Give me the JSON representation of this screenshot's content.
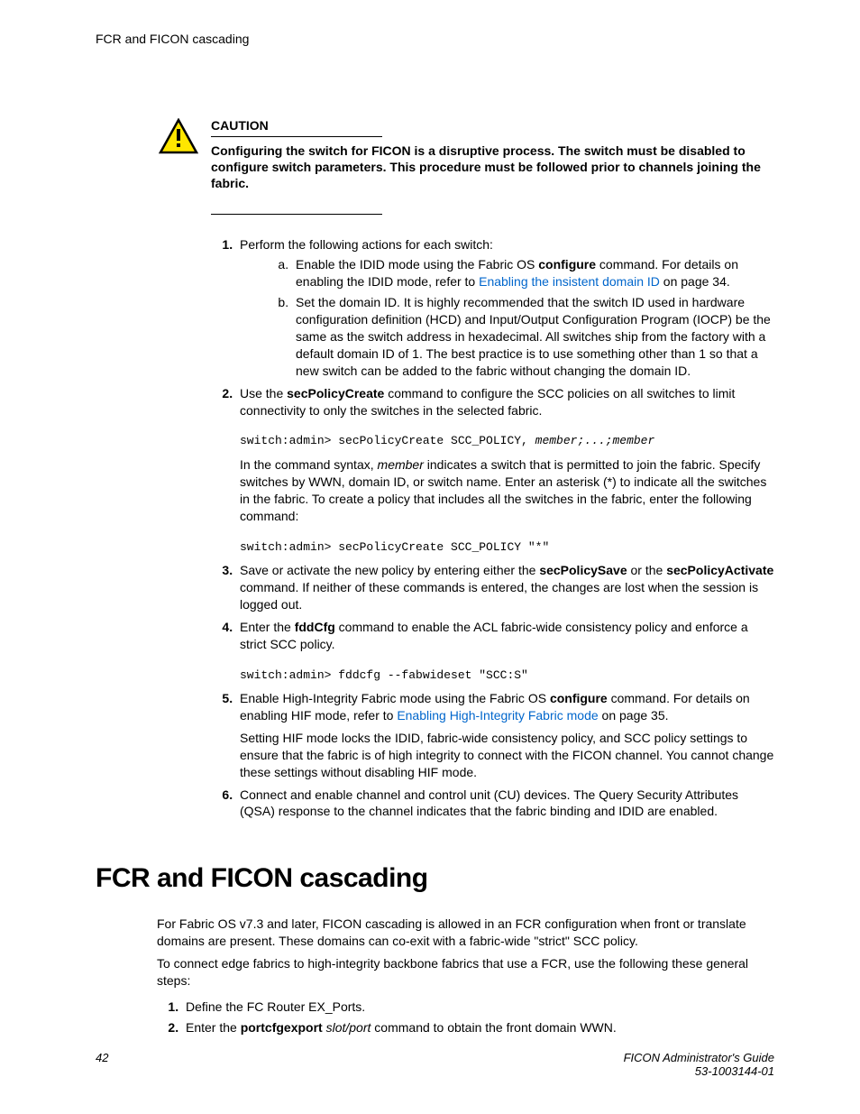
{
  "header": {
    "running": "FCR and FICON cascading"
  },
  "caution": {
    "label": "CAUTION",
    "text": "Configuring the switch for FICON is a disruptive process. The switch must be disabled to configure switch parameters. This procedure must be followed prior to channels joining the fabric."
  },
  "steps": {
    "s1": {
      "text": "Perform the following actions for each switch:",
      "a_pre": "Enable the IDID mode using the Fabric OS ",
      "a_cmd": "configure",
      "a_mid": " command. For details on enabling the IDID mode, refer to ",
      "a_link": "Enabling the insistent domain ID",
      "a_post": " on page 34.",
      "b": "Set the domain ID. It is highly recommended that the switch ID used in hardware configuration definition (HCD) and Input/Output Configuration Program (IOCP) be the same as the switch address in hexadecimal. All switches ship from the factory with a default domain ID of 1. The best practice is to use something other than 1 so that a new switch can be added to the fabric without changing the domain ID."
    },
    "s2": {
      "pre": "Use the ",
      "cmd": "secPolicyCreate",
      "post": " command to configure the SCC policies on all switches to limit connectivity to only the switches in the selected fabric.",
      "code1_a": "switch:admin> secPolicyCreate SCC_POLICY, ",
      "code1_b": "member;...;member",
      "p2a": "In the command syntax, ",
      "p2b": "member",
      "p2c": " indicates a switch that is permitted to join the fabric. Specify switches by WWN, domain ID, or switch name. Enter an asterisk (*) to indicate all the switches in the fabric. To create a policy that includes all the switches in the fabric, enter the following command:",
      "code2": "switch:admin> secPolicyCreate SCC_POLICY \"*\""
    },
    "s3": {
      "pre": "Save or activate the new policy by entering either the ",
      "cmd1": "secPolicySave",
      "mid": " or the ",
      "cmd2": "secPolicyActivate",
      "post": " command. If neither of these commands is entered, the changes are lost when the session is logged out."
    },
    "s4": {
      "pre": "Enter the ",
      "cmd": "fddCfg",
      "post": " command to enable the ACL fabric-wide consistency policy and enforce a strict SCC policy.",
      "code": "switch:admin> fddcfg --fabwideset \"SCC:S\""
    },
    "s5": {
      "pre": "Enable High-Integrity Fabric mode using the Fabric OS ",
      "cmd": "configure",
      "mid": " command. For details on enabling HIF mode, refer to ",
      "link": "Enabling High-Integrity Fabric mode",
      "post": " on page 35.",
      "p2": "Setting HIF mode locks the IDID, fabric-wide consistency policy, and SCC policy settings to ensure that the fabric is of high integrity to connect with the FICON channel. You cannot change these settings without disabling HIF mode."
    },
    "s6": "Connect and enable channel and control unit (CU) devices. The Query Security Attributes (QSA) response to the channel indicates that the fabric binding and IDID are enabled."
  },
  "section2": {
    "title": "FCR and FICON cascading",
    "p1": "For Fabric OS v7.3 and later, FICON cascading is allowed in an FCR configuration when front or translate domains are present. These domains can co-exit with a fabric-wide \"strict\" SCC policy.",
    "p2": "To connect edge fabrics to high-integrity backbone fabrics that use a FCR, use the following these general steps:",
    "step1": "Define the FC Router EX_Ports.",
    "step2_pre": "Enter the ",
    "step2_cmd": "portcfgexport",
    "step2_arg": " slot/port",
    "step2_post": " command to obtain the front domain WWN."
  },
  "footer": {
    "page": "42",
    "title": "FICON Administrator's Guide",
    "docnum": "53-1003144-01"
  }
}
